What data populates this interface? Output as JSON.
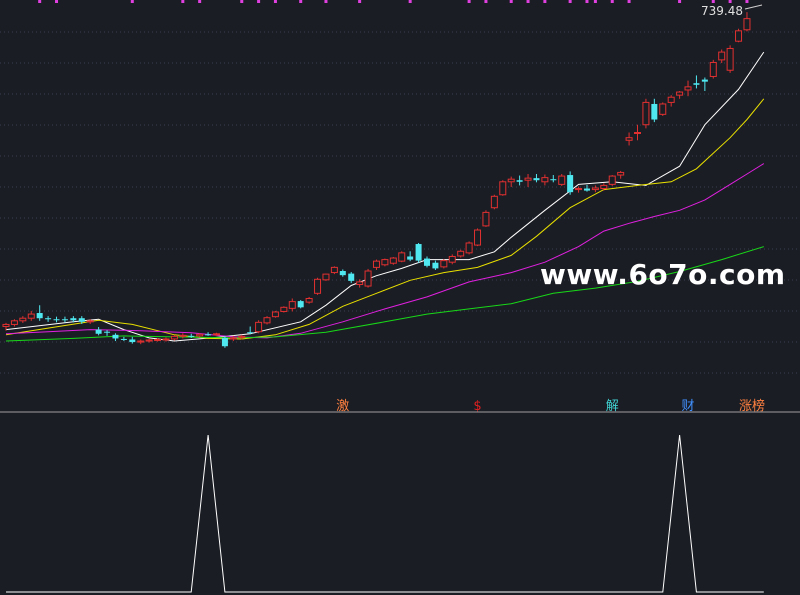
{
  "chart_data": [
    {
      "type": "candlestick",
      "price_label": "739.48",
      "price_label_value": 739.48,
      "ylim": [
        120,
        760
      ],
      "grid": "horizontal-dotted",
      "candles": [
        {
          "o": 146,
          "h": 153,
          "l": 138,
          "c": 150,
          "k": "up"
        },
        {
          "o": 150,
          "h": 160,
          "l": 146,
          "c": 157,
          "k": "up"
        },
        {
          "o": 157,
          "h": 166,
          "l": 153,
          "c": 162,
          "k": "up"
        },
        {
          "o": 162,
          "h": 176,
          "l": 157,
          "c": 170,
          "k": "up"
        },
        {
          "o": 172,
          "h": 187,
          "l": 157,
          "c": 162,
          "k": "down"
        },
        {
          "o": 162,
          "h": 166,
          "l": 155,
          "c": 160,
          "k": "down"
        },
        {
          "o": 160,
          "h": 165,
          "l": 154,
          "c": 159,
          "k": "down"
        },
        {
          "o": 159,
          "h": 165,
          "l": 154,
          "c": 160,
          "k": "down"
        },
        {
          "o": 162,
          "h": 166,
          "l": 154,
          "c": 158,
          "k": "down"
        },
        {
          "o": 162,
          "h": 166,
          "l": 151,
          "c": 155,
          "k": "down"
        },
        {
          "o": 155,
          "h": 160,
          "l": 151,
          "c": 157,
          "k": "up"
        },
        {
          "o": 140,
          "h": 145,
          "l": 129,
          "c": 132,
          "k": "down"
        },
        {
          "o": 136,
          "h": 139,
          "l": 128,
          "c": 134,
          "k": "down"
        },
        {
          "o": 130,
          "h": 133,
          "l": 118,
          "c": 123,
          "k": "down"
        },
        {
          "o": 122,
          "h": 126,
          "l": 118,
          "c": 121,
          "k": "down"
        },
        {
          "o": 121,
          "h": 126,
          "l": 113,
          "c": 116,
          "k": "down"
        },
        {
          "o": 116,
          "h": 121,
          "l": 112,
          "c": 118,
          "k": "up"
        },
        {
          "o": 118,
          "h": 122,
          "l": 115,
          "c": 120,
          "k": "up"
        },
        {
          "o": 120,
          "h": 124,
          "l": 117,
          "c": 121,
          "k": "up"
        },
        {
          "o": 120,
          "h": 125,
          "l": 117,
          "c": 122,
          "k": "up"
        },
        {
          "o": 122,
          "h": 130,
          "l": 119,
          "c": 127,
          "k": "up"
        },
        {
          "o": 127,
          "h": 133,
          "l": 123,
          "c": 129,
          "k": "up"
        },
        {
          "o": 128,
          "h": 132,
          "l": 124,
          "c": 127,
          "k": "down"
        },
        {
          "o": 128,
          "h": 133,
          "l": 125,
          "c": 131,
          "k": "up"
        },
        {
          "o": 131,
          "h": 135,
          "l": 128,
          "c": 129,
          "k": "down"
        },
        {
          "o": 131,
          "h": 134,
          "l": 128,
          "c": 132,
          "k": "up"
        },
        {
          "o": 124,
          "h": 128,
          "l": 105,
          "c": 108,
          "k": "down"
        },
        {
          "o": 122,
          "h": 128,
          "l": 118,
          "c": 124,
          "k": "up"
        },
        {
          "o": 125,
          "h": 130,
          "l": 121,
          "c": 127,
          "k": "up"
        },
        {
          "o": 135,
          "h": 146,
          "l": 131,
          "c": 134,
          "k": "down"
        },
        {
          "o": 136,
          "h": 158,
          "l": 133,
          "c": 154,
          "k": "up"
        },
        {
          "o": 153,
          "h": 166,
          "l": 150,
          "c": 163,
          "k": "up"
        },
        {
          "o": 165,
          "h": 176,
          "l": 163,
          "c": 174,
          "k": "up"
        },
        {
          "o": 175,
          "h": 185,
          "l": 173,
          "c": 183,
          "k": "up"
        },
        {
          "o": 181,
          "h": 200,
          "l": 175,
          "c": 194,
          "k": "up"
        },
        {
          "o": 195,
          "h": 197,
          "l": 181,
          "c": 183,
          "k": "down"
        },
        {
          "o": 193,
          "h": 203,
          "l": 190,
          "c": 200,
          "k": "up"
        },
        {
          "o": 210,
          "h": 240,
          "l": 207,
          "c": 237,
          "k": "up"
        },
        {
          "o": 236,
          "h": 248,
          "l": 234,
          "c": 247,
          "k": "up"
        },
        {
          "o": 250,
          "h": 262,
          "l": 247,
          "c": 260,
          "k": "up"
        },
        {
          "o": 253,
          "h": 256,
          "l": 242,
          "c": 245,
          "k": "down"
        },
        {
          "o": 248,
          "h": 251,
          "l": 230,
          "c": 234,
          "k": "down"
        },
        {
          "o": 232,
          "h": 237,
          "l": 221,
          "c": 227,
          "k": "up"
        },
        {
          "o": 224,
          "h": 257,
          "l": 221,
          "c": 253,
          "k": "up"
        },
        {
          "o": 260,
          "h": 275,
          "l": 255,
          "c": 272,
          "k": "up"
        },
        {
          "o": 265,
          "h": 277,
          "l": 262,
          "c": 275,
          "k": "up"
        },
        {
          "o": 268,
          "h": 280,
          "l": 265,
          "c": 278,
          "k": "up"
        },
        {
          "o": 272,
          "h": 291,
          "l": 270,
          "c": 288,
          "k": "up"
        },
        {
          "o": 281,
          "h": 291,
          "l": 272,
          "c": 275,
          "k": "down"
        },
        {
          "o": 305,
          "h": 307,
          "l": 269,
          "c": 273,
          "k": "down"
        },
        {
          "o": 277,
          "h": 281,
          "l": 260,
          "c": 263,
          "k": "down"
        },
        {
          "o": 269,
          "h": 273,
          "l": 255,
          "c": 258,
          "k": "down"
        },
        {
          "o": 261,
          "h": 276,
          "l": 258,
          "c": 273,
          "k": "up"
        },
        {
          "o": 270,
          "h": 285,
          "l": 266,
          "c": 281,
          "k": "up"
        },
        {
          "o": 282,
          "h": 294,
          "l": 279,
          "c": 291,
          "k": "up"
        },
        {
          "o": 288,
          "h": 310,
          "l": 285,
          "c": 307,
          "k": "up"
        },
        {
          "o": 303,
          "h": 335,
          "l": 301,
          "c": 332,
          "k": "up"
        },
        {
          "o": 340,
          "h": 370,
          "l": 338,
          "c": 366,
          "k": "up"
        },
        {
          "o": 375,
          "h": 400,
          "l": 372,
          "c": 397,
          "k": "up"
        },
        {
          "o": 400,
          "h": 428,
          "l": 398,
          "c": 425,
          "k": "up"
        },
        {
          "o": 425,
          "h": 435,
          "l": 415,
          "c": 430,
          "k": "up"
        },
        {
          "o": 428,
          "h": 437,
          "l": 418,
          "c": 425,
          "k": "down"
        },
        {
          "o": 428,
          "h": 440,
          "l": 415,
          "c": 432,
          "k": "up"
        },
        {
          "o": 432,
          "h": 440,
          "l": 424,
          "c": 428,
          "k": "down"
        },
        {
          "o": 425,
          "h": 439,
          "l": 418,
          "c": 433,
          "k": "up"
        },
        {
          "o": 430,
          "h": 438,
          "l": 424,
          "c": 428,
          "k": "down"
        },
        {
          "o": 420,
          "h": 440,
          "l": 417,
          "c": 436,
          "k": "up"
        },
        {
          "o": 438,
          "h": 445,
          "l": 400,
          "c": 405,
          "k": "down"
        },
        {
          "o": 410,
          "h": 416,
          "l": 404,
          "c": 412,
          "k": "up"
        },
        {
          "o": 412,
          "h": 419,
          "l": 406,
          "c": 408,
          "k": "down"
        },
        {
          "o": 410,
          "h": 418,
          "l": 405,
          "c": 413,
          "k": "up"
        },
        {
          "o": 412,
          "h": 422,
          "l": 408,
          "c": 418,
          "k": "up"
        },
        {
          "o": 420,
          "h": 438,
          "l": 417,
          "c": 436,
          "k": "up"
        },
        {
          "o": 438,
          "h": 446,
          "l": 431,
          "c": 443,
          "k": "up"
        },
        {
          "o": 505,
          "h": 520,
          "l": 495,
          "c": 510,
          "k": "up"
        },
        {
          "o": 520,
          "h": 535,
          "l": 505,
          "c": 520,
          "k": "up"
        },
        {
          "o": 535,
          "h": 585,
          "l": 528,
          "c": 578,
          "k": "up"
        },
        {
          "o": 575,
          "h": 585,
          "l": 540,
          "c": 545,
          "k": "down"
        },
        {
          "o": 555,
          "h": 578,
          "l": 552,
          "c": 575,
          "k": "up"
        },
        {
          "o": 578,
          "h": 592,
          "l": 570,
          "c": 588,
          "k": "up"
        },
        {
          "o": 592,
          "h": 600,
          "l": 585,
          "c": 598,
          "k": "up"
        },
        {
          "o": 602,
          "h": 620,
          "l": 590,
          "c": 608,
          "k": "up"
        },
        {
          "o": 612,
          "h": 630,
          "l": 605,
          "c": 615,
          "k": "down"
        },
        {
          "o": 618,
          "h": 626,
          "l": 600,
          "c": 622,
          "k": "down"
        },
        {
          "o": 628,
          "h": 660,
          "l": 624,
          "c": 655,
          "k": "up"
        },
        {
          "o": 660,
          "h": 680,
          "l": 654,
          "c": 675,
          "k": "up"
        },
        {
          "o": 640,
          "h": 688,
          "l": 635,
          "c": 682,
          "k": "up"
        },
        {
          "o": 696,
          "h": 720,
          "l": 694,
          "c": 716,
          "k": "up"
        },
        {
          "o": 718,
          "h": 752,
          "l": 715,
          "c": 739.48,
          "k": "up"
        }
      ],
      "moving_averages": [
        {
          "color": "#ffffff",
          "values": [
            [
              0,
              140
            ],
            [
              8,
              155
            ],
            [
              11,
              160
            ],
            [
              14,
              140
            ],
            [
              17,
              124
            ],
            [
              20,
              118
            ],
            [
              25,
              125
            ],
            [
              29,
              132
            ],
            [
              35,
              155
            ],
            [
              38,
              187
            ],
            [
              41,
              225
            ],
            [
              44,
              244
            ],
            [
              47,
              258
            ],
            [
              50,
              275
            ],
            [
              55,
              275
            ],
            [
              58,
              290
            ],
            [
              60,
              318
            ],
            [
              64,
              370
            ],
            [
              68,
              420
            ],
            [
              72,
              425
            ],
            [
              76,
              418
            ],
            [
              80,
              455
            ],
            [
              83,
              535
            ],
            [
              87,
              603
            ],
            [
              90,
              675
            ]
          ]
        },
        {
          "color": "#e8e000",
          "values": [
            [
              0,
              130
            ],
            [
              5,
              143
            ],
            [
              11,
              158
            ],
            [
              15,
              150
            ],
            [
              20,
              130
            ],
            [
              24,
              123
            ],
            [
              28,
              122
            ],
            [
              32,
              130
            ],
            [
              36,
              150
            ],
            [
              40,
              185
            ],
            [
              44,
              210
            ],
            [
              48,
              235
            ],
            [
              52,
              250
            ],
            [
              56,
              260
            ],
            [
              60,
              283
            ],
            [
              63,
              320
            ],
            [
              67,
              375
            ],
            [
              71,
              410
            ],
            [
              75,
              418
            ],
            [
              79,
              425
            ],
            [
              82,
              450
            ],
            [
              86,
              510
            ],
            [
              88,
              545
            ],
            [
              90,
              585
            ]
          ]
        },
        {
          "color": "#e020e0",
          "values": [
            [
              0,
              132
            ],
            [
              5,
              136
            ],
            [
              10,
              140
            ],
            [
              16,
              138
            ],
            [
              22,
              134
            ],
            [
              27,
              126
            ],
            [
              31,
              124
            ],
            [
              35,
              133
            ],
            [
              40,
              155
            ],
            [
              45,
              180
            ],
            [
              50,
              203
            ],
            [
              55,
              232
            ],
            [
              60,
              250
            ],
            [
              64,
              270
            ],
            [
              68,
              300
            ],
            [
              71,
              330
            ],
            [
              74,
              345
            ],
            [
              77,
              358
            ],
            [
              80,
              370
            ],
            [
              83,
              390
            ],
            [
              86,
              420
            ],
            [
              88,
              440
            ],
            [
              90,
              460
            ]
          ]
        },
        {
          "color": "#18d818",
          "values": [
            [
              0,
              118
            ],
            [
              8,
              123
            ],
            [
              14,
              128
            ],
            [
              20,
              126
            ],
            [
              27,
              124
            ],
            [
              32,
              126
            ],
            [
              38,
              135
            ],
            [
              45,
              155
            ],
            [
              50,
              170
            ],
            [
              55,
              180
            ],
            [
              60,
              190
            ],
            [
              65,
              210
            ],
            [
              70,
              220
            ],
            [
              75,
              233
            ],
            [
              80,
              252
            ],
            [
              85,
              275
            ],
            [
              90,
              300
            ]
          ]
        }
      ],
      "top_marker_columns": [
        4,
        6,
        15,
        21,
        23,
        28,
        30,
        32,
        35,
        38,
        42,
        48,
        55,
        57,
        60,
        62,
        64,
        67,
        69,
        70,
        72,
        74,
        80,
        84,
        86,
        88
      ]
    },
    {
      "type": "line",
      "ylim": [
        0,
        1
      ],
      "series": [
        {
          "color": "#ffffff",
          "values": [
            [
              0,
              0
            ],
            [
              22,
              0
            ],
            [
              24,
              1
            ],
            [
              26,
              0
            ],
            [
              78,
              0
            ],
            [
              80,
              1
            ],
            [
              82,
              0
            ],
            [
              90,
              0
            ]
          ]
        }
      ]
    }
  ],
  "signals": [
    {
      "label": "激",
      "color": "#ff8040",
      "x": 40
    },
    {
      "label": "$",
      "color": "#e02020",
      "x": 56
    },
    {
      "label": "解",
      "color": "#40d0d0",
      "x": 72
    },
    {
      "label": "财",
      "color": "#4090ff",
      "x": 81
    },
    {
      "label": "涨榜",
      "color": "#ff8040",
      "x": 88.6
    }
  ],
  "watermark": "www.6o7o.com",
  "colors": {
    "background": "#1b1d24",
    "up": "#e03030",
    "down": "#50e8f0",
    "grid": "#3a3f50",
    "divider": "#a0a0a0",
    "marker": "#e040e0"
  }
}
